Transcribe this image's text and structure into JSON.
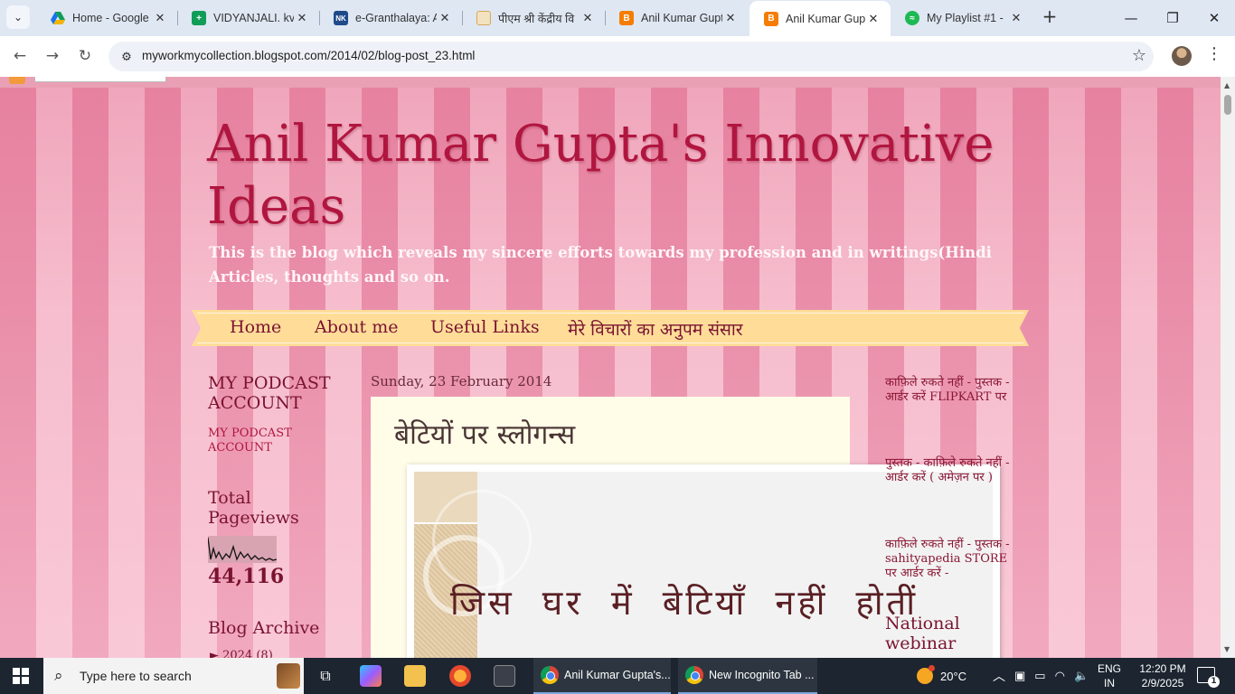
{
  "browser": {
    "tabs": [
      {
        "title": "Home - Google",
        "favicon": "google-drive-icon",
        "color": "#1a73e8"
      },
      {
        "title": "VIDYANJALI. kvs",
        "favicon": "google-sheets-icon",
        "color": "#0f9d58"
      },
      {
        "title": "e-Granthalaya: A",
        "favicon": "nic-icon",
        "color": "#1e4a8a"
      },
      {
        "title": "पीएम श्री केंद्रीय वि",
        "favicon": "kv-emblem-icon",
        "color": "#d9a65a"
      },
      {
        "title": "Anil Kumar Gupt",
        "favicon": "blogger-icon",
        "color": "#f57d00"
      },
      {
        "title": "Anil Kumar Gupt",
        "favicon": "blogger-icon",
        "color": "#f57d00",
        "active": true
      },
      {
        "title": "My Playlist #1 -",
        "favicon": "spotify-icon",
        "color": "#1db954"
      }
    ],
    "url": "myworkmycollection.blogspot.com/2014/02/blog-post_23.html"
  },
  "blog": {
    "title": "Anil Kumar Gupta's Innovative Ideas",
    "description": "This is the blog which reveals my sincere efforts towards my profession and in writings(Hindi Articles, thoughts and so on.",
    "nav": [
      "Home",
      "About me",
      "Useful Links",
      "मेरे विचारों का अनुपम संसार"
    ]
  },
  "left_sidebar": {
    "podcast_heading": "MY PODCAST ACCOUNT",
    "podcast_link": "MY PODCAST ACCOUNT",
    "pageviews_heading": "Total Pageviews",
    "pageviews_count": "44,116",
    "archive_heading": "Blog Archive",
    "archive_item": "► 2024 (8)"
  },
  "post": {
    "date": "Sunday, 23 February 2014",
    "title": "बेटियों पर स्लोगन्स",
    "image_text": "जिस घर में बेटियाँ नहीं होतीं"
  },
  "right_sidebar": {
    "links": [
      "काफ़िले रुकते नहीं - पुस्तक - आर्डर करें FLIPKART पर",
      "पुस्तक - काफ़िले रुकते नहीं - आर्डर करें ( अमेज़न पर )",
      "काफ़िले रुकते नहीं - पुस्तक - sahityapedia STORE पर आर्डर करें -"
    ],
    "national_heading": "National webinar"
  },
  "taskbar": {
    "search_placeholder": "Type here to search",
    "apps": [
      {
        "label": "Anil Kumar Gupta's..."
      },
      {
        "label": "New Incognito Tab ..."
      }
    ],
    "weather": "20°C",
    "lang_line1": "ENG",
    "lang_line2": "IN",
    "time": "12:20 PM",
    "date": "2/9/2025",
    "notifications": "1"
  }
}
